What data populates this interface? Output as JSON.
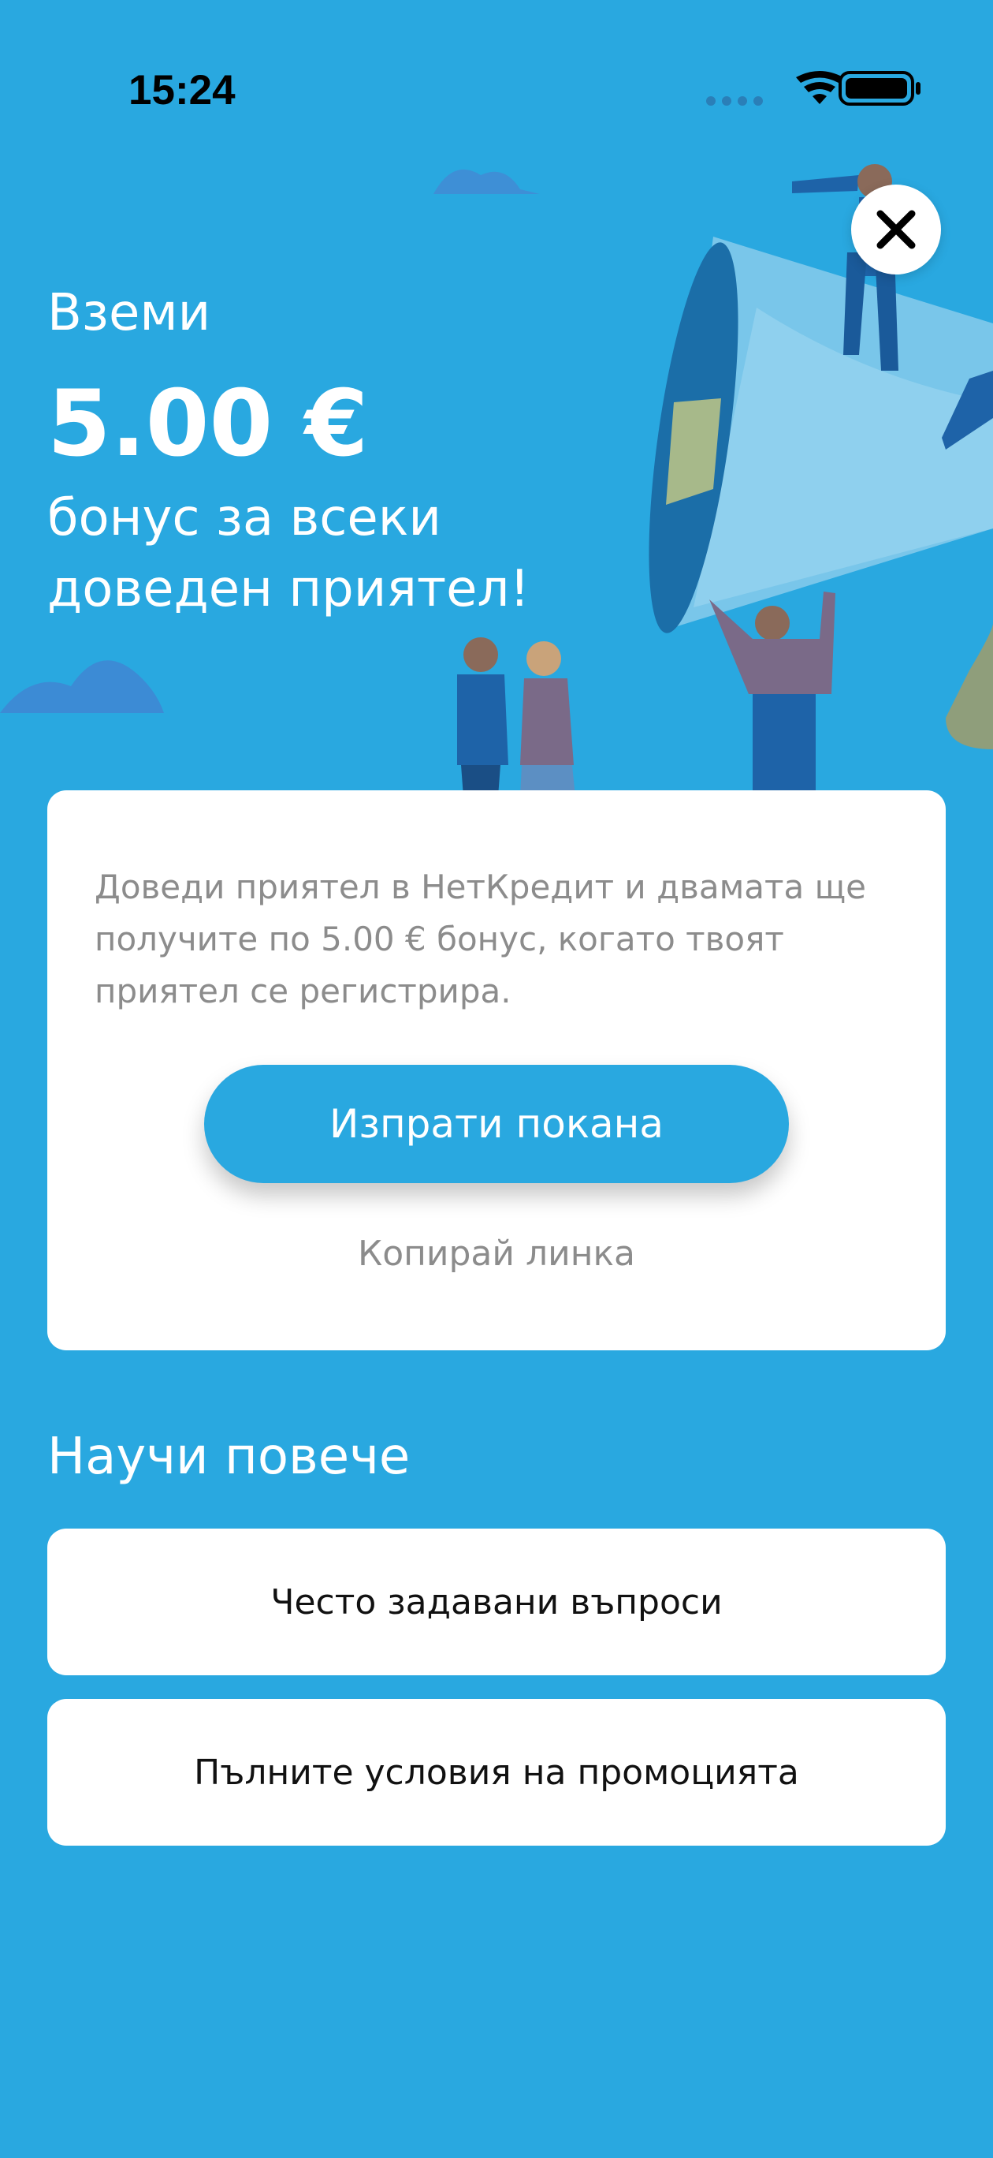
{
  "status_bar": {
    "time": "15:24"
  },
  "hero": {
    "headline_small": "Вземи",
    "amount": "5.00 €",
    "subline": "бонус за всеки доведен приятел!"
  },
  "card": {
    "description": "Доведи приятел в НетКредит и двамата ще получите по 5.00 € бонус, когато твоят приятел се регистрира.",
    "invite_button": "Изпрати покана",
    "copy_link": "Копирай линка"
  },
  "learn_more": {
    "title": "Научи повече",
    "items": [
      {
        "label": "Често задавани въпроси"
      },
      {
        "label": "Пълните условия на промоцията"
      }
    ]
  },
  "icons": {
    "close": "close-icon",
    "wifi": "wifi-icon",
    "battery": "battery-icon",
    "signal": "signal-icon"
  },
  "colors": {
    "background": "#29A8E0",
    "card": "#FFFFFF",
    "muted_text": "#8C8C8C"
  }
}
